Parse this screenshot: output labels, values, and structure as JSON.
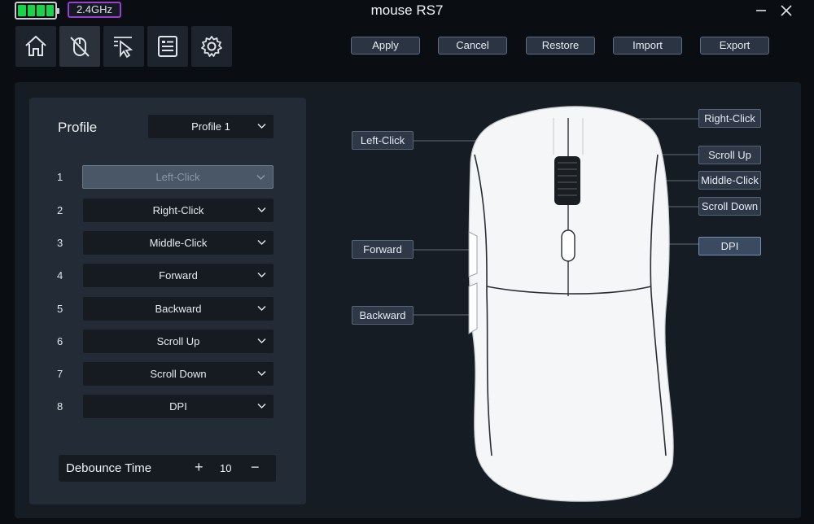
{
  "status": {
    "battery_cells": 4,
    "battery_color": "#19d34a",
    "connection": "2.4GHz"
  },
  "app": {
    "title": "mouse RS7"
  },
  "nav": [
    {
      "icon": "home-icon"
    },
    {
      "icon": "mouse-settings-icon",
      "active": true
    },
    {
      "icon": "pointer-speed-icon"
    },
    {
      "icon": "macro-list-icon"
    },
    {
      "icon": "gear-icon"
    }
  ],
  "actions": {
    "apply": "Apply",
    "cancel": "Cancel",
    "restore": "Restore",
    "import": "Import",
    "export": "Export"
  },
  "profile": {
    "label": "Profile",
    "selected": "Profile 1"
  },
  "buttons": [
    {
      "num": "1",
      "value": "Left-Click"
    },
    {
      "num": "2",
      "value": "Right-Click"
    },
    {
      "num": "3",
      "value": "Middle-Click"
    },
    {
      "num": "4",
      "value": "Forward"
    },
    {
      "num": "5",
      "value": "Backward"
    },
    {
      "num": "6",
      "value": "Scroll Up"
    },
    {
      "num": "7",
      "value": "Scroll Down"
    },
    {
      "num": "8",
      "value": "DPI"
    }
  ],
  "debounce": {
    "label": "Debounce Time",
    "plus": "+",
    "value": "10",
    "minus": "−"
  },
  "mouse_labels": {
    "left_click": "Left-Click",
    "right_click": "Right-Click",
    "scroll_up": "Scroll Up",
    "middle_click": "Middle-Click",
    "scroll_down": "Scroll Down",
    "forward": "Forward",
    "dpi": "DPI",
    "backward": "Backward"
  },
  "colors": {
    "accent": "#9b3ed6",
    "panel": "#232b36",
    "background": "#0a0d12"
  }
}
